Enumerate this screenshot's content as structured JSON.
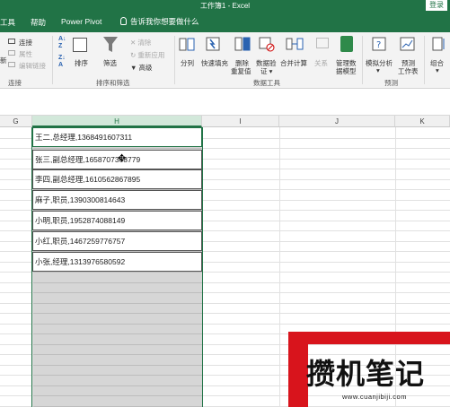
{
  "window": {
    "title": "工作簿1 - Excel",
    "login_label": "登录"
  },
  "menu": {
    "items": [
      "工具",
      "帮助",
      "Power Pivot"
    ],
    "tell_me": "告诉我你想要做什么"
  },
  "ribbon": {
    "connections": {
      "partial": "新",
      "connect": "连接",
      "properties": "属性",
      "edit_links": "编辑链接",
      "group": "连接"
    },
    "sort_filter": {
      "sort": "排序",
      "filter": "筛选",
      "clear": "清除",
      "reapply": "重新应用",
      "advanced": "高级",
      "group": "排序和筛选"
    },
    "data_tools": {
      "split": "分列",
      "flash_fill": "快速填充",
      "remove_dup_1": "删除",
      "remove_dup_2": "重复值",
      "validation_1": "数据验",
      "validation_2": "证 ▾",
      "consolidate": "合并计算",
      "relations": "关系",
      "manage_1": "管理数",
      "manage_2": "据模型",
      "group": "数据工具"
    },
    "forecast": {
      "whatif": "模拟分析",
      "forecast_1": "预测",
      "forecast_2": "工作表",
      "group": "预测"
    },
    "outline": {
      "group_btn": "组合"
    }
  },
  "columns": {
    "G": "G",
    "H": "H",
    "I": "I",
    "J": "J",
    "K": "K"
  },
  "cells": [
    "王二,总经理,1368491607311",
    "张三,副总经理,1658707368779",
    "李四,副总经理,1610562867895",
    "麻子,职员,1390300814643",
    "小明,职员,1952874088149",
    "小红,职员,1467259776757",
    "小张,经理,1313976580592"
  ],
  "watermark": {
    "text": "攒机笔记",
    "url": "www.cuanjibiji.com"
  },
  "colors": {
    "excel_green": "#217346",
    "watermark_red": "#d8141c"
  }
}
